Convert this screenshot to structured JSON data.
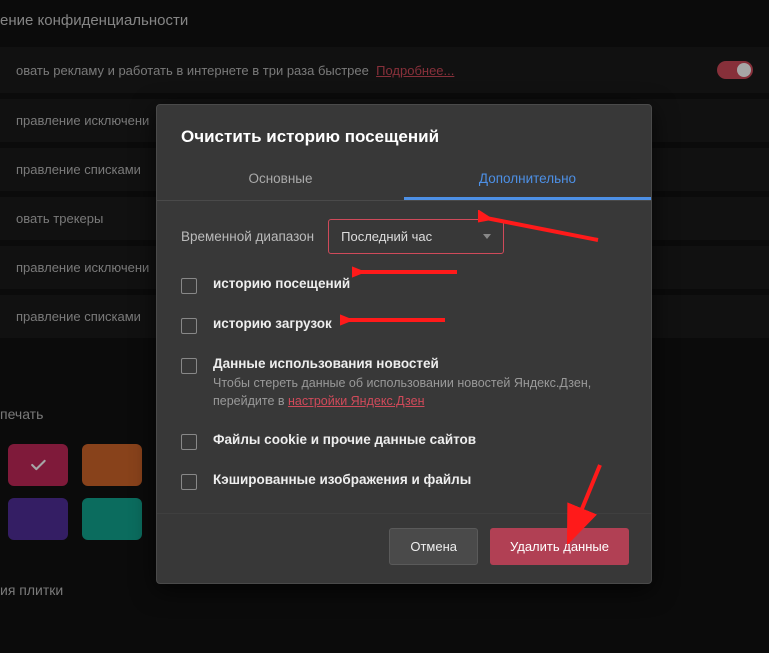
{
  "bg": {
    "header": "ение конфиденциальности",
    "row_ads_text": "овать рекламу и работать в интернете в три раза быстрее",
    "row_ads_link": "Подробнее...",
    "rows": [
      "правление исключени",
      "правление списками",
      "овать трекеры",
      "правление исключени",
      "правление списками"
    ],
    "print_label": "печать",
    "tiles_label": "ия плитки",
    "tile_colors": [
      "#c4285a",
      "#d2662a",
      "#3a4a52",
      "#502f9a",
      "#12a791"
    ]
  },
  "modal": {
    "title": "Очистить историю посещений",
    "tabs": {
      "basic": "Основные",
      "advanced": "Дополнительно"
    },
    "range_label": "Временной диапазон",
    "range_value": "Последний час",
    "items": [
      {
        "title": "историю посещений",
        "desc": "",
        "link": ""
      },
      {
        "title": "историю загрузок",
        "desc": "",
        "link": ""
      },
      {
        "title": "Данные использования новостей",
        "desc": "Чтобы стереть данные об использовании новостей Яндекс.Дзен, перейдите в ",
        "link": "настройки Яндекс.Дзен"
      },
      {
        "title": "Файлы cookie и прочие данные сайтов",
        "desc": "",
        "link": ""
      },
      {
        "title": "Кэшированные изображения и файлы",
        "desc": "",
        "link": ""
      }
    ],
    "cancel": "Отмена",
    "delete": "Удалить данные"
  }
}
